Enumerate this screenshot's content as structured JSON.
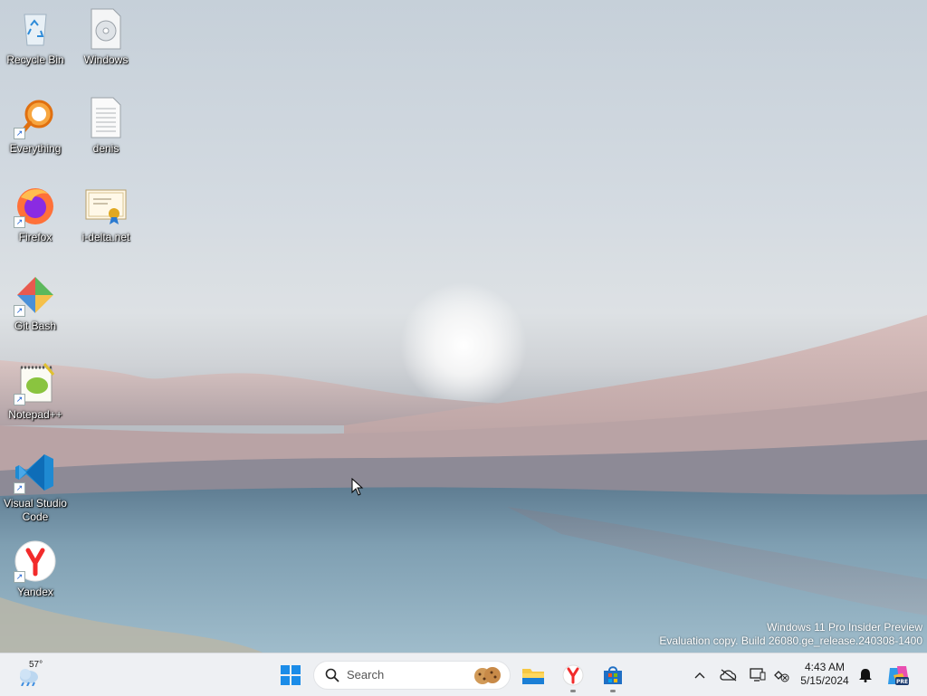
{
  "desktop": {
    "icons": [
      {
        "label": "Recycle Bin",
        "icon": "recycle-bin-icon"
      },
      {
        "label": "Windows",
        "icon": "disc-file-icon"
      },
      {
        "label": "Everything",
        "icon": "everything-search-icon"
      },
      {
        "label": "denis",
        "icon": "text-file-icon"
      },
      {
        "label": "Firefox",
        "icon": "firefox-icon"
      },
      {
        "label": "i-delta.net",
        "icon": "certificate-icon"
      },
      {
        "label": "Git Bash",
        "icon": "git-bash-icon"
      },
      {
        "label": "Notepad++",
        "icon": "notepad-plus-plus-icon"
      },
      {
        "label": "Visual Studio Code",
        "icon": "vscode-icon"
      },
      {
        "label": "Yandex",
        "icon": "yandex-browser-icon"
      }
    ],
    "watermark": {
      "line1": "Windows 11 Pro Insider Preview",
      "line2": "Evaluation copy. Build 26080.ge_release.240308-1400"
    }
  },
  "taskbar": {
    "weather": {
      "temp": "57°",
      "icon": "weather-cloud-icon"
    },
    "search": {
      "placeholder": "Search"
    },
    "pinned": [
      "start-icon",
      "file-explorer-icon",
      "yandex-browser-icon",
      "microsoft-store-icon"
    ],
    "tray": {
      "icons": [
        "chevron-up-icon",
        "onedrive-offline-icon",
        "display-icon",
        "network-disconnected-icon",
        "notification-bell-icon",
        "copilot-pre-icon"
      ],
      "time": "4:43 AM",
      "date": "5/15/2024"
    }
  },
  "colors": {
    "accent": "#0078d4",
    "taskbar_bg": "#eef0f3"
  }
}
